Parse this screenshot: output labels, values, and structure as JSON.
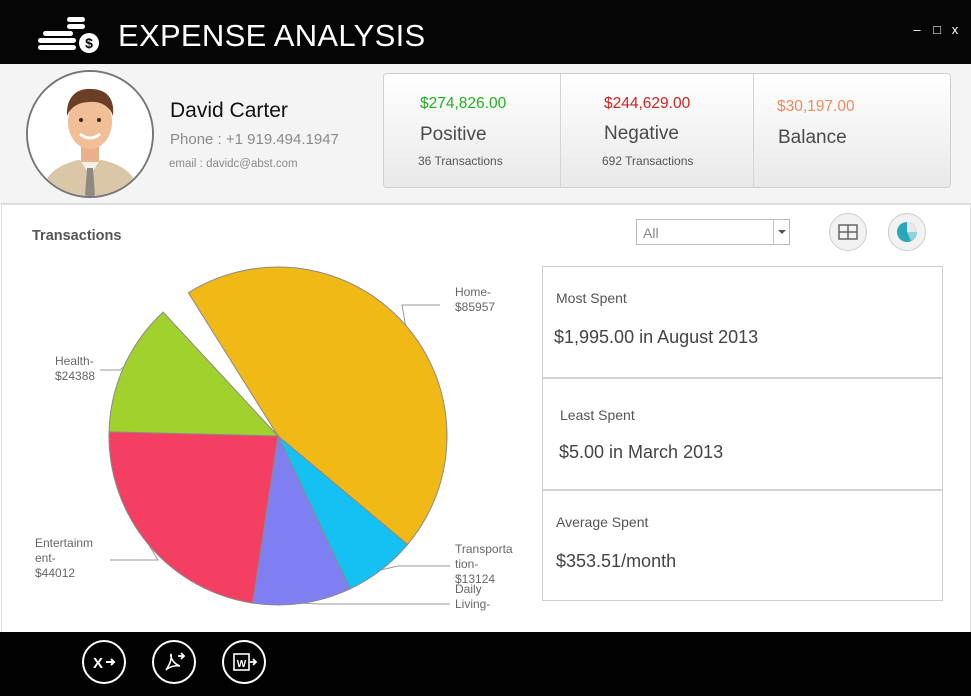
{
  "app": {
    "title": "EXPENSE ANALYSIS",
    "minimize_label": "–",
    "maximize_label": "□",
    "close_label": "x"
  },
  "user": {
    "name": "David Carter",
    "phone": "Phone : +1 919.494.1947",
    "email": "email : davidc@abst.com"
  },
  "stats": [
    {
      "amount": "$274,826.00",
      "label": "Positive",
      "count": "36 Transactions",
      "color": "#22b11d"
    },
    {
      "amount": "$244,629.00",
      "label": "Negative",
      "count": "692 Transactions",
      "color": "#d3201f"
    },
    {
      "amount": "$30,197.00",
      "label": "Balance",
      "color": "#f08a5c"
    }
  ],
  "transactions": {
    "title": "Transactions",
    "filter": {
      "selected": "All"
    },
    "view_buttons": [
      {
        "icon": "grid-view-icon"
      },
      {
        "icon": "pie-chart-icon"
      }
    ]
  },
  "chart_data": {
    "type": "pie",
    "slices": [
      {
        "label": "Home",
        "value": 85957,
        "color": "#f0b915",
        "label_lines": [
          "Home-",
          "$85957"
        ]
      },
      {
        "label": "Transportation",
        "value": 13124,
        "color": "#14c1f2",
        "label_lines": [
          "Transporta",
          "tion-",
          "$13124"
        ]
      },
      {
        "label": "Daily Living",
        "color": "#7f7ff2",
        "label_lines": [
          "Daily",
          "Living-"
        ]
      },
      {
        "label": "Entertainment",
        "value": 44012,
        "color": "#f53f62",
        "label_lines": [
          "Entertainm",
          "ent-",
          "$44012"
        ]
      },
      {
        "label": "Health",
        "value": 24388,
        "color": "#a1d12c",
        "label_lines": [
          "Health-",
          "$24388"
        ]
      }
    ],
    "slice_fractions": [
      0.45,
      0.069,
      0.094,
      0.23,
      0.127
    ]
  },
  "metrics": [
    {
      "label": "Most Spent",
      "value": "$1,995.00 in August 2013"
    },
    {
      "label": "Least Spent",
      "value": "$5.00 in March 2013"
    },
    {
      "label": "Average Spent",
      "value": "$353.51/month"
    }
  ],
  "export_buttons": [
    {
      "icon": "excel-export-icon"
    },
    {
      "icon": "pdf-export-icon"
    },
    {
      "icon": "word-export-icon"
    }
  ]
}
